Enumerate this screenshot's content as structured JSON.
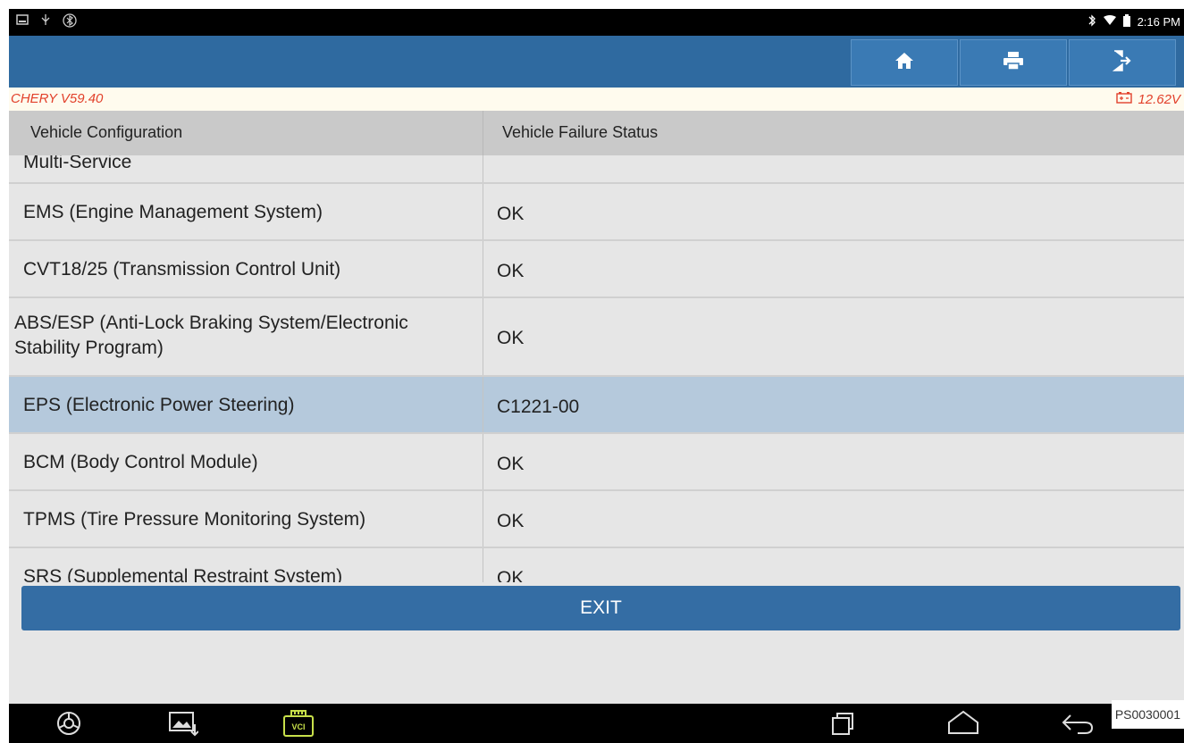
{
  "status_bar": {
    "time": "2:16 PM",
    "left_icons": [
      "screenshot-icon",
      "usb-icon",
      "bluetooth-icon"
    ],
    "right_icons": [
      "bluetooth-icon",
      "wifi-icon",
      "battery-icon"
    ]
  },
  "toolbar": {
    "buttons": [
      "home-icon",
      "print-icon",
      "exit-icon"
    ]
  },
  "info_bar": {
    "version": "CHERY V59.40",
    "voltage": "12.62V",
    "color": "#e2412b"
  },
  "table": {
    "columns": [
      "Vehicle Configuration",
      "Vehicle Failure Status"
    ],
    "rows": [
      {
        "system": "Multi-Service",
        "status": ""
      },
      {
        "system": "EMS (Engine Management System)",
        "status": "OK"
      },
      {
        "system": "CVT18/25 (Transmission Control Unit)",
        "status": "OK"
      },
      {
        "system": "ABS/ESP (Anti-Lock Braking System/Electronic Stability Program)",
        "status": "OK"
      },
      {
        "system": "EPS (Electronic Power Steering)",
        "status": "C1221-00",
        "selected": true
      },
      {
        "system": "BCM (Body Control Module)",
        "status": "OK"
      },
      {
        "system": "TPMS (Tire Pressure Monitoring System)",
        "status": "OK"
      },
      {
        "system": "SRS (Supplemental Restraint System)",
        "status": "OK"
      }
    ]
  },
  "exit_button": "EXIT",
  "nav_bar": {
    "vci_label": "VCI",
    "icons": [
      "browser-icon",
      "gallery-icon",
      "vci-icon",
      "recent-apps-icon",
      "home-nav-icon",
      "back-icon"
    ]
  },
  "figure_id": "PS0030001",
  "accent_color": "#2f6aa0"
}
